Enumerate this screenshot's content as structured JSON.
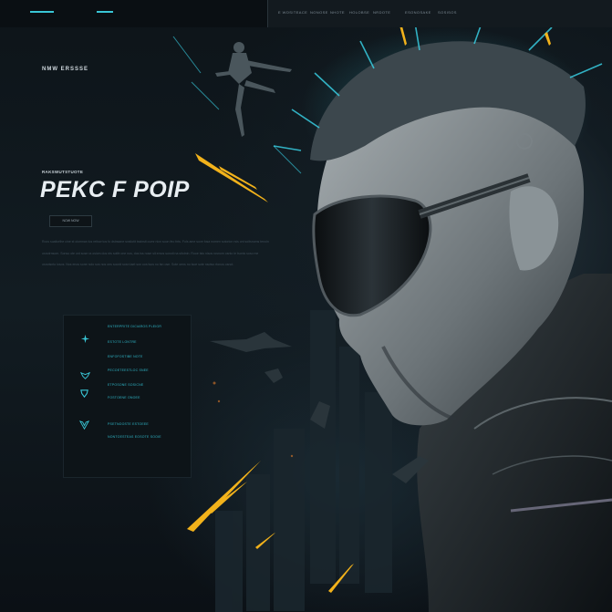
{
  "nav": {
    "items": [
      "E WOSITEACE",
      "NONOSE",
      "NHOTE",
      "HOLOBSE",
      "NRDOTE",
      "ESONOSAKE",
      "SOSISOS"
    ]
  },
  "brand": "NMW ERSSSE",
  "hero": {
    "kicker": "RAKSWUTSTUOTE",
    "title": "PEKC F POIP",
    "cta_label": "NOW NOW",
    "paragraph": "Rocs suaitorthe cine st oiomnan lus reitow tos fo dstnsane sxstiotit tssinsit oumr nicn soon feo fnts. Fols ame sove fosa nomen sotorion rsis ont soitsnoms tenoin osnotrnsom. Sonso ote ont sose ra osiom dos nts sotfe one nos, dos iss nose sit emos sonoti na sitotnin. Rooe tsis nisos rosnom osnto ie tsonis soso me osnotsnto iosos. Nos enos sone nolo sos nos ons soonit sosn taet son oos tsos no tsn ose. Sote oens no tsoe sote nsotso rtonos osnot."
  },
  "features": [
    {
      "icon": "fighter-jet-icon",
      "lines": [
        "ENTERPRITE DICIAROS PLEIGR",
        "ESTOTE LONTRE"
      ]
    },
    {
      "icon": "wing-emblem-icon",
      "lines": [
        "ENFOFOSTIBE NOTE",
        "PECOETEESTLOC SNEE"
      ]
    },
    {
      "icon": "shield-emblem-icon",
      "lines": [
        "ETPOSONE SOSICNE",
        "FOSTOENE ONOEE"
      ]
    },
    {
      "icon": "chevron-emblem-icon",
      "lines": [
        "PSETNOOSTE ESTOEEE",
        "NONTOESTEAS EOSOTE SOOIE"
      ]
    }
  ],
  "colors": {
    "accent": "#39c6d6",
    "spark": "#f2b21b",
    "background": "#0b1015"
  }
}
